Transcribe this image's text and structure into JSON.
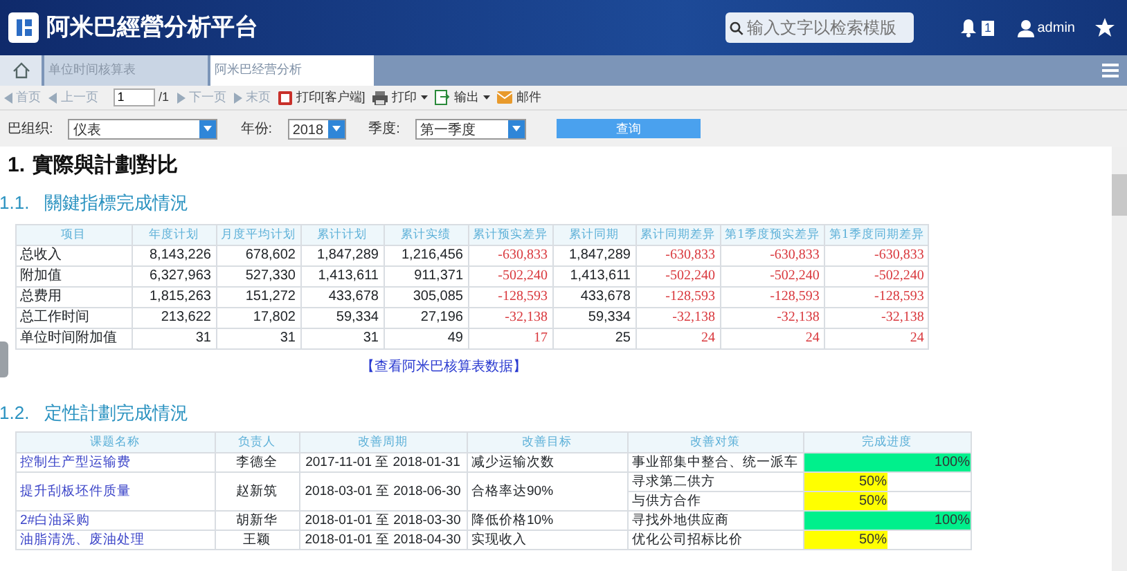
{
  "header": {
    "title": "阿米巴經營分析平台",
    "search": {
      "placeholder": "输入文字以检索模版"
    },
    "notification_count": "1",
    "user": "admin"
  },
  "tabs": [
    {
      "label": "单位时间核算表",
      "selected": false
    },
    {
      "label": "阿米巴经营分析",
      "selected": true
    }
  ],
  "toolbar": {
    "items": [
      {
        "kind": "nav",
        "label": "首页",
        "disabled": true
      },
      {
        "kind": "nav",
        "label": "上一页",
        "disabled": true
      },
      {
        "kind": "page",
        "value": "1",
        "total": "/1",
        "disabled": false
      },
      {
        "kind": "nav",
        "label": "下一页",
        "disabled": true
      },
      {
        "kind": "nav",
        "label": "末页",
        "disabled": true
      },
      {
        "kind": "pdf",
        "label": "打印[客户端]",
        "disabled": false
      },
      {
        "kind": "print",
        "label": "打印",
        "disabled": false
      },
      {
        "kind": "export",
        "label": "输出",
        "disabled": false
      },
      {
        "kind": "mail",
        "label": "邮件",
        "disabled": false
      }
    ]
  },
  "filters": [
    {
      "label": "巴组织:",
      "value": "仪表"
    },
    {
      "label": "年份:",
      "value": "2018"
    },
    {
      "label": "季度:",
      "value": "第一季度"
    }
  ],
  "query_button": "查询",
  "heading": {
    "number": "1.",
    "text": "實際與計劃對比"
  },
  "section_1": {
    "number": "1.1.",
    "title": "關鍵指標完成情況",
    "columns": [
      {
        "label": "项目",
        "kind": "text"
      },
      {
        "label": "年度计划",
        "kind": "num"
      },
      {
        "label": "月度平均计划",
        "kind": "num"
      },
      {
        "label": "累计计划",
        "kind": "num"
      },
      {
        "label": "累计实绩",
        "kind": "num"
      },
      {
        "label": "累计预实差异",
        "kind": "diff"
      },
      {
        "label": "累计同期",
        "kind": "num"
      },
      {
        "label": "累计同期差异",
        "kind": "diff"
      },
      {
        "label": "第1季度预实差异",
        "kind": "diff"
      },
      {
        "label": "第1季度同期差异",
        "kind": "diff"
      }
    ],
    "rows": [
      [
        "总收入",
        "8,143,226",
        "678,602",
        "1,847,289",
        "1,216,456",
        "-630,833",
        "1,847,289",
        "-630,833",
        "-630,833",
        "-630,833"
      ],
      [
        "附加值",
        "6,327,963",
        "527,330",
        "1,413,611",
        "911,371",
        "-502,240",
        "1,413,611",
        "-502,240",
        "-502,240",
        "-502,240"
      ],
      [
        "总费用",
        "1,815,263",
        "151,272",
        "433,678",
        "305,085",
        "-128,593",
        "433,678",
        "-128,593",
        "-128,593",
        "-128,593"
      ],
      [
        "总工作时间",
        "213,622",
        "17,802",
        "59,334",
        "27,196",
        "-32,138",
        "59,334",
        "-32,138",
        "-32,138",
        "-32,138"
      ],
      [
        "单位时间附加值",
        "31",
        "31",
        "31",
        "49",
        "17",
        "25",
        "24",
        "24",
        "24"
      ]
    ],
    "link": "【查看阿米巴核算表数据】"
  },
  "section_2": {
    "number": "1.2.",
    "title": "定性計劃完成情況",
    "columns": [
      "课题名称",
      "负责人",
      "改善周期",
      "改善目标",
      "改善对策",
      "完成进度"
    ],
    "rows": [
      {
        "name": "控制生产型运输费",
        "owner": "李德全",
        "period": "2017-11-01 至 2018-01-31",
        "target": "减少运输次数",
        "measures": [
          {
            "text": "事业部集中整合、统一派车",
            "level": 1,
            "reading": "100%",
            "color": "#00f08c"
          }
        ]
      },
      {
        "name": "提升刮板坯件质量",
        "owner": "赵新筑",
        "period": "2018-03-01 至 2018-06-30",
        "target": "合格率达90%",
        "measures": [
          {
            "text": "寻求第二供方",
            "level": 0.5,
            "reading": "50%",
            "color": "#ffff00"
          },
          {
            "text": "与供方合作",
            "level": 0.5,
            "reading": "50%",
            "color": "#ffff00"
          }
        ]
      },
      {
        "name": "2#白油采购",
        "owner": "胡新华",
        "period": "2018-01-01 至 2018-03-30",
        "target": "降低价格10%",
        "measures": [
          {
            "text": "寻找外地供应商",
            "level": 1,
            "reading": "100%",
            "color": "#00f08c"
          }
        ]
      },
      {
        "name": "油脂清洗、废油处理",
        "owner": "王颖",
        "period": "2018-01-01 至 2018-04-30",
        "target": "实现收入",
        "measures": [
          {
            "text": "优化公司招标比价",
            "level": 0.5,
            "reading": "50%",
            "color": "#ffff00"
          }
        ]
      }
    ]
  }
}
